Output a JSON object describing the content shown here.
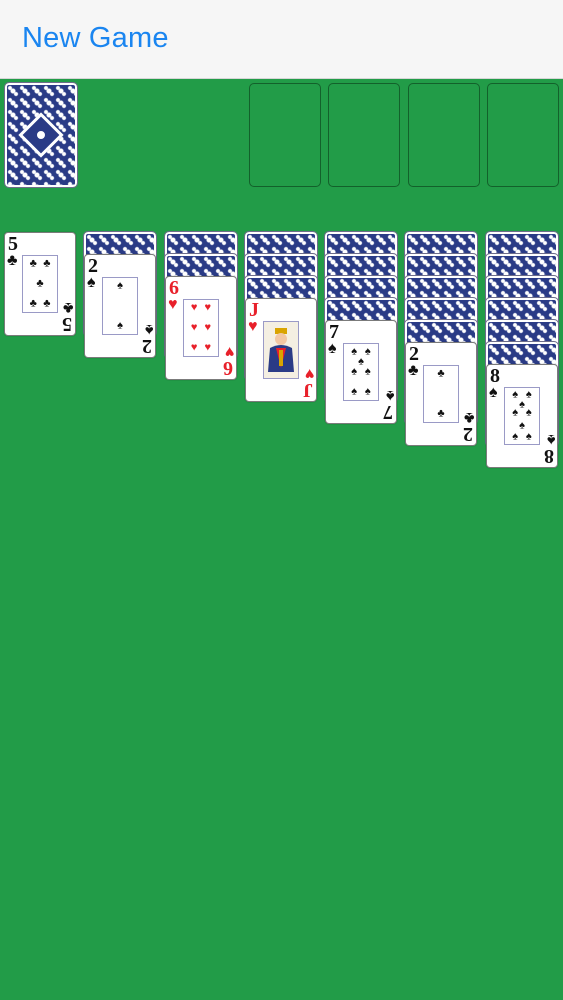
{
  "toolbar": {
    "new_game_label": "New Game"
  },
  "colors": {
    "felt": "#229c48",
    "toolbar_bg": "#f6f6f6",
    "accent": "#1a85f0",
    "card_back": "#2a3b86",
    "red_suit": "#e8202a",
    "black_suit": "#111111"
  },
  "stock": {
    "face_down": true
  },
  "foundations": {
    "count": 4
  },
  "tableau": [
    {
      "face_down": 0,
      "top": {
        "rank": "5",
        "suit": "♣",
        "color": "black"
      }
    },
    {
      "face_down": 1,
      "top": {
        "rank": "2",
        "suit": "♠",
        "color": "black"
      }
    },
    {
      "face_down": 2,
      "top": {
        "rank": "6",
        "suit": "♥",
        "color": "red"
      }
    },
    {
      "face_down": 3,
      "top": {
        "rank": "J",
        "suit": "♥",
        "color": "red"
      }
    },
    {
      "face_down": 4,
      "top": {
        "rank": "7",
        "suit": "♠",
        "color": "black"
      }
    },
    {
      "face_down": 5,
      "top": {
        "rank": "2",
        "suit": "♣",
        "color": "black"
      }
    },
    {
      "face_down": 6,
      "top": {
        "rank": "8",
        "suit": "♠",
        "color": "black"
      }
    }
  ]
}
